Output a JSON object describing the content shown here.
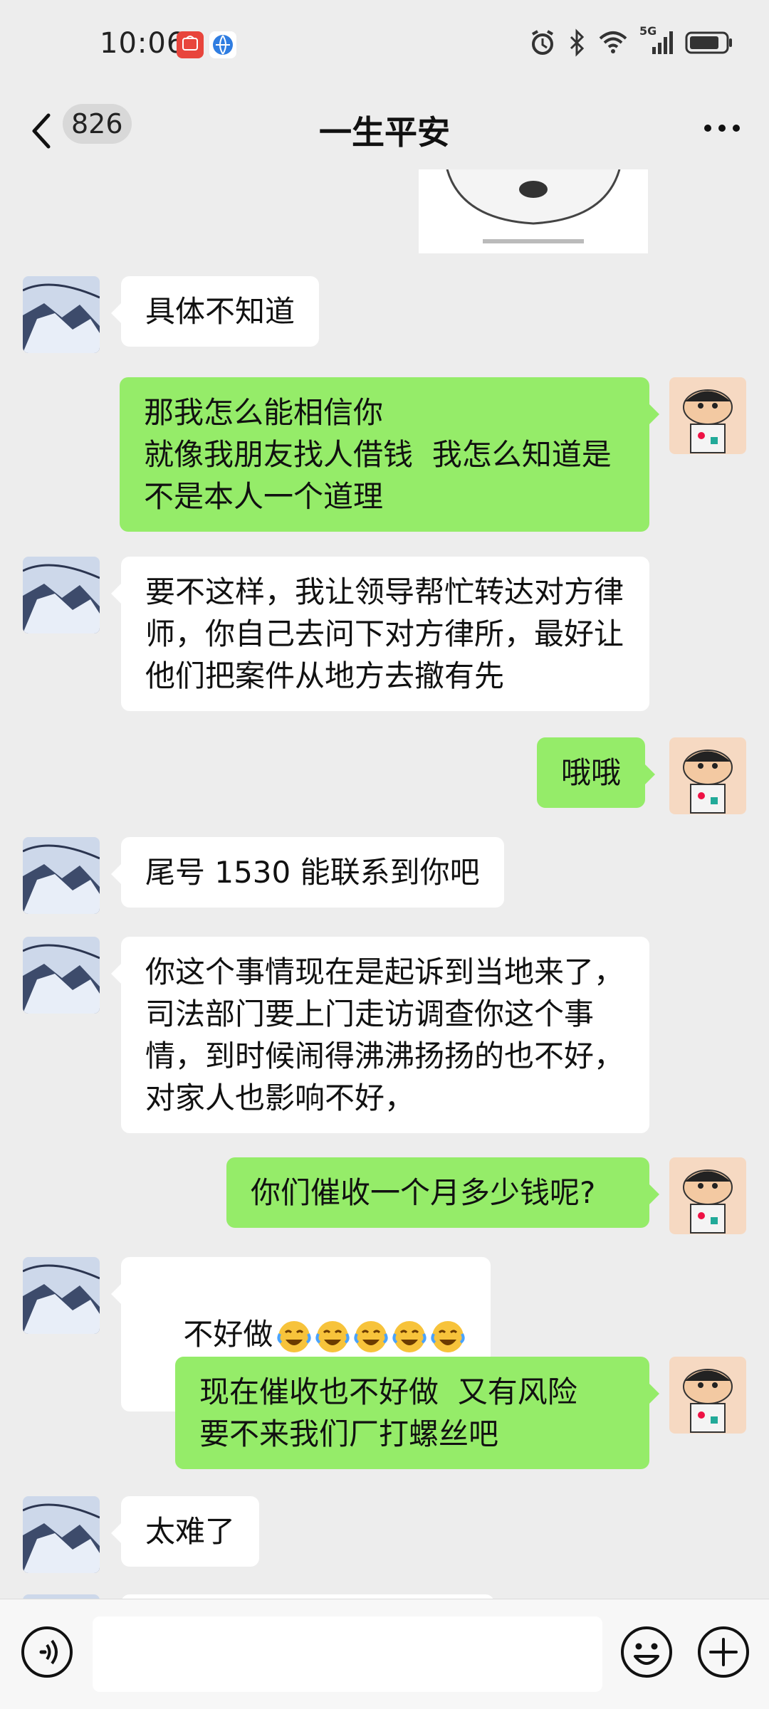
{
  "status_bar": {
    "time": "10:06",
    "network": "5G"
  },
  "header": {
    "back_count": "826",
    "title": "一生平安"
  },
  "messages": [
    {
      "side": "left",
      "text": "具体不知道"
    },
    {
      "side": "right",
      "text": "那我怎么能相信你\n就像我朋友找人借钱  我怎么知道是不是本人一个道理"
    },
    {
      "side": "left",
      "text": "要不这样，我让领导帮忙转达对方律师，你自己去问下对方律所，最好让他们把案件从地方去撤有先"
    },
    {
      "side": "right",
      "text": "哦哦"
    },
    {
      "side": "left",
      "text": "尾号 1530 能联系到你吧"
    },
    {
      "side": "left",
      "text": "你这个事情现在是起诉到当地来了，司法部门要上门走访调查你这个事情，到时候闹得沸沸扬扬的也不好，对家人也影响不好，"
    },
    {
      "side": "right",
      "text": "你们催收一个月多少钱呢?"
    },
    {
      "side": "left",
      "text": "不好做",
      "emoji": "tears-of-joy",
      "emoji_count": 5
    },
    {
      "side": "right",
      "text": "现在催收也不好做  又有风险\n要不来我们厂打螺丝吧"
    },
    {
      "side": "left",
      "text": "太难了"
    }
  ],
  "input_bar": {
    "placeholder": ""
  },
  "colors": {
    "background": "#ededed",
    "self_bubble": "#95ec69",
    "other_bubble": "#ffffff"
  }
}
